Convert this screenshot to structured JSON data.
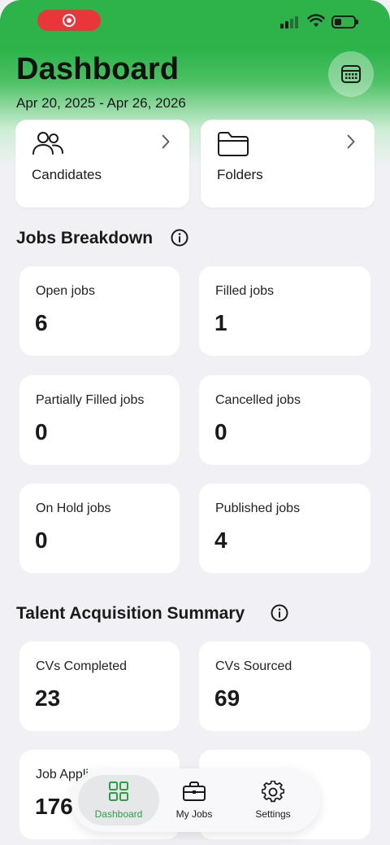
{
  "header": {
    "title": "Dashboard",
    "date_range": "Apr 20, 2025 - Apr 26, 2026",
    "calendar_icon": "calendar-icon"
  },
  "shortcuts": [
    {
      "label": "Candidates",
      "icon": "people-icon"
    },
    {
      "label": "Folders",
      "icon": "folder-icon"
    }
  ],
  "jobs_breakdown": {
    "title": "Jobs Breakdown",
    "cards": [
      {
        "label": "Open jobs",
        "value": "6"
      },
      {
        "label": "Filled jobs",
        "value": "1"
      },
      {
        "label": "Partially Filled jobs",
        "value": "0"
      },
      {
        "label": "Cancelled jobs",
        "value": "0"
      },
      {
        "label": "On Hold jobs",
        "value": "0"
      },
      {
        "label": "Published jobs",
        "value": "4"
      }
    ]
  },
  "talent_summary": {
    "title": "Talent Acquisition Summary",
    "cards": [
      {
        "label": "CVs Completed",
        "value": "23"
      },
      {
        "label": "CVs Sourced",
        "value": "69"
      },
      {
        "label": "Job Appli",
        "value": "176"
      }
    ]
  },
  "bottom_nav": {
    "items": [
      {
        "label": "Dashboard",
        "icon": "grid-icon",
        "active": true
      },
      {
        "label": "My Jobs",
        "icon": "briefcase-icon",
        "active": false
      },
      {
        "label": "Settings",
        "icon": "gear-icon",
        "active": false
      }
    ]
  },
  "colors": {
    "accent": "#2db34a",
    "active_label": "#2aa045",
    "record": "#e8363b"
  }
}
